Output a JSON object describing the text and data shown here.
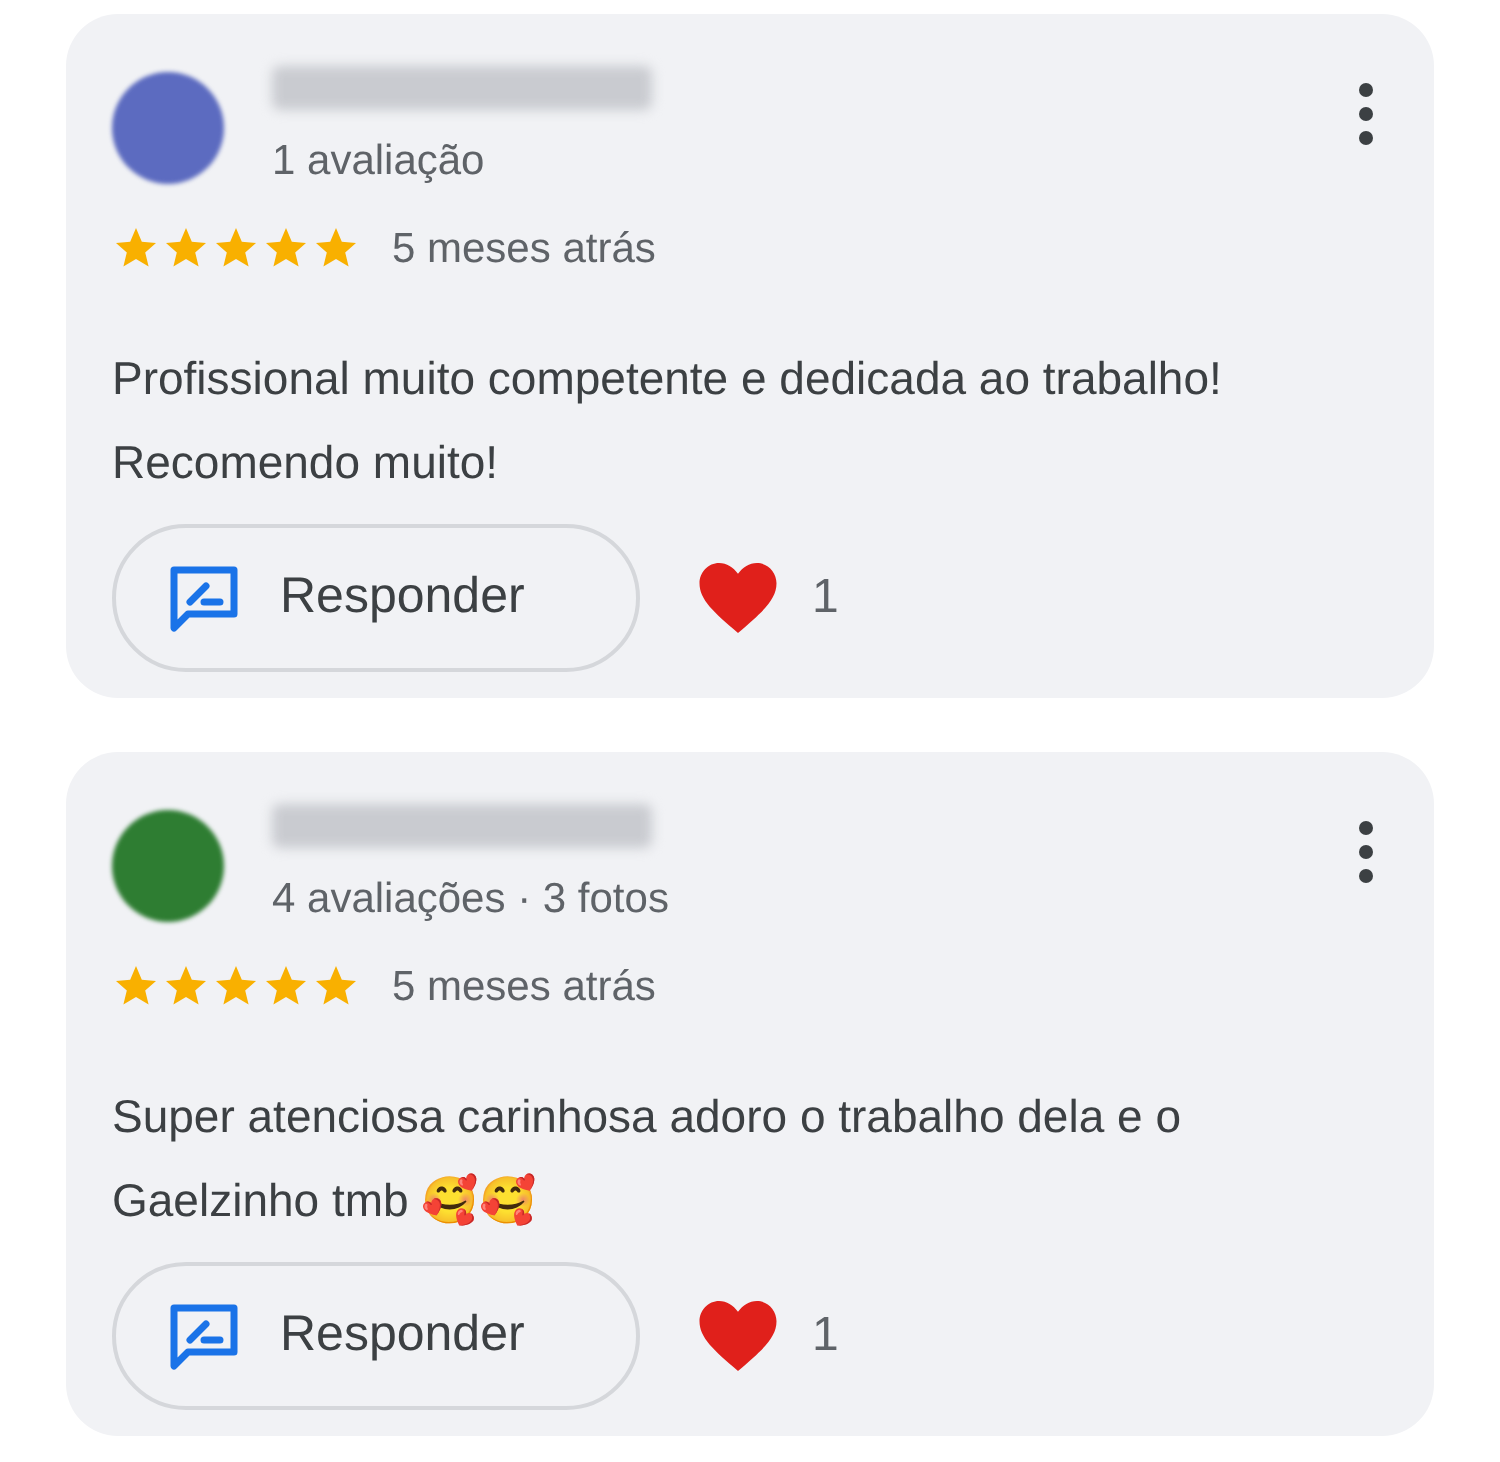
{
  "reviews": [
    {
      "color": "#5c6bc0",
      "subtitle": "1 avaliação",
      "stars": 5,
      "time": "5 meses atrás",
      "text": "Profissional muito competente e dedicada ao trabalho! Recomendo muito!",
      "reply_label": "Responder",
      "likes": "1"
    },
    {
      "color": "#2e7d32",
      "subtitle": "4 avaliações · 3 fotos",
      "stars": 5,
      "time": "5 meses atrás",
      "text": "Super atenciosa carinhosa adoro o trabalho dela e o Gaelzinho tmb 🥰🥰",
      "reply_label": "Responder",
      "likes": "1"
    }
  ]
}
